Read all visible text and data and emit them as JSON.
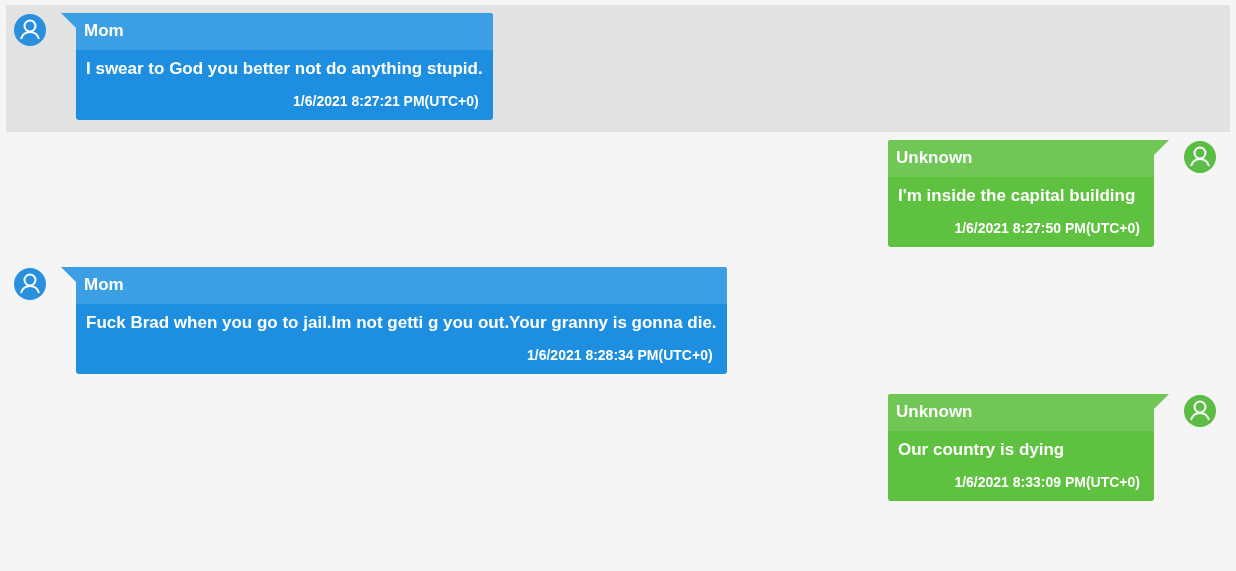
{
  "messages": [
    {
      "kind": "incoming",
      "selected": true,
      "sender": "Mom",
      "text": "I swear to God you better not do anything stupid.",
      "time": "1/6/2021 8:27:21 PM(UTC+0)"
    },
    {
      "kind": "outgoing",
      "selected": false,
      "sender": "Unknown",
      "text": "I'm inside the capital building",
      "time": "1/6/2021 8:27:50 PM(UTC+0)"
    },
    {
      "kind": "incoming",
      "selected": false,
      "sender": "Mom",
      "text": "Fuck Brad when you go to jail.Im not getti g you out.Your granny is gonna die.",
      "time": "1/6/2021 8:28:34 PM(UTC+0)"
    },
    {
      "kind": "outgoing",
      "selected": false,
      "sender": "Unknown",
      "text": "Our country is dying",
      "time": "1/6/2021 8:33:09 PM(UTC+0)"
    }
  ]
}
